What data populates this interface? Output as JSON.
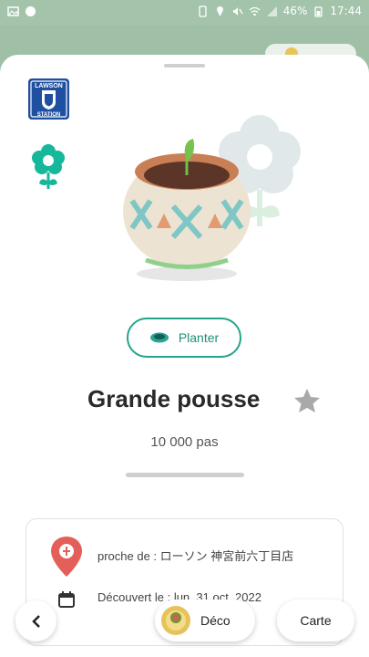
{
  "status_bar": {
    "battery": "46%",
    "time": "17:44",
    "left_icons": [
      "gallery-icon",
      "chat-icon"
    ],
    "right_icons": [
      "sim-icon",
      "location-icon",
      "mute-icon",
      "wifi-icon",
      "signal-icon",
      "battery-icon"
    ]
  },
  "header": {
    "logo_text_top": "LAWSON",
    "logo_text_bottom": "STATION",
    "logo_color": "#1f4fa0"
  },
  "item": {
    "action_label": "Planter",
    "title": "Grande pousse",
    "steps": "10 000 pas",
    "accent_color": "#22a58a"
  },
  "info": {
    "near_label": "proche de : ローソン 神宮前六丁目店",
    "found_label": "Découvert le : lun. 31 oct. 2022"
  },
  "bottom_nav": {
    "deco_label": "Déco",
    "map_label": "Carte"
  }
}
